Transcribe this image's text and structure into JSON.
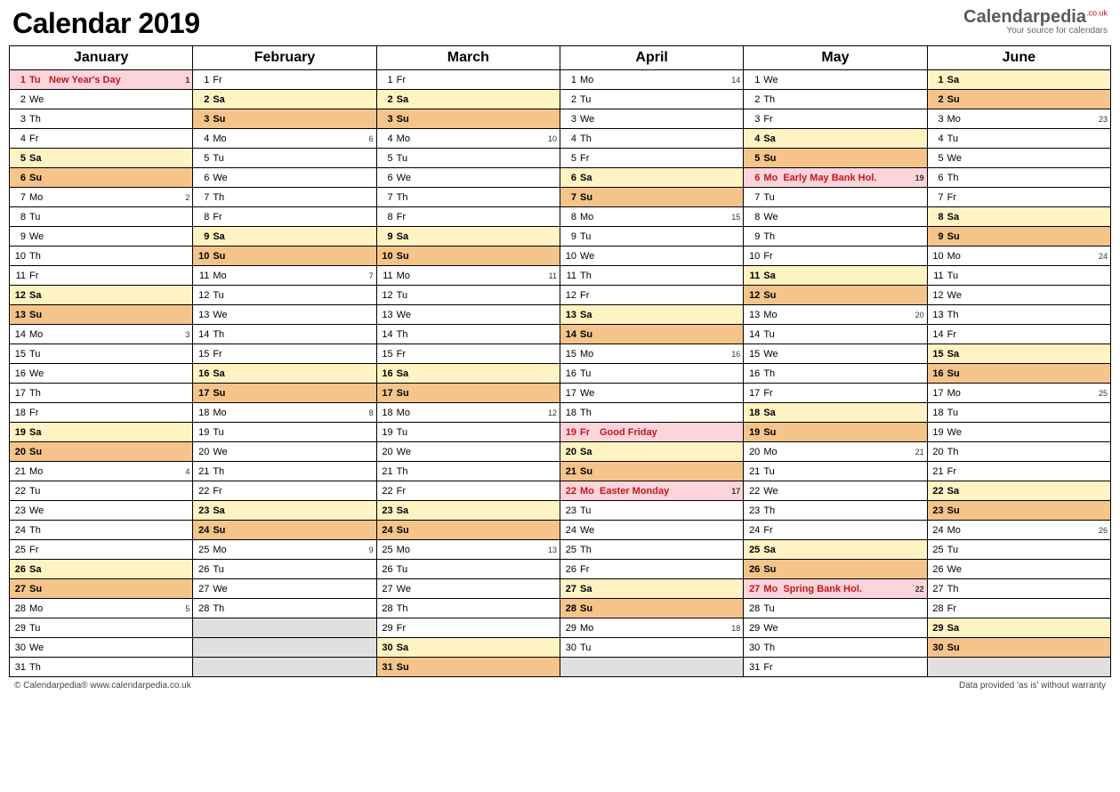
{
  "title": "Calendar 2019",
  "logo": {
    "text": "Calendarpedia",
    "suffix": ".co.uk",
    "tagline": "Your source for calendars"
  },
  "footer": {
    "left": "© Calendarpedia®   www.calendarpedia.co.uk",
    "right": "Data provided 'as is' without warranty"
  },
  "months": [
    "January",
    "February",
    "March",
    "April",
    "May",
    "June"
  ],
  "grid": [
    [
      {
        "d": 1,
        "w": "Tu",
        "e": "New Year's Day",
        "wk": 1,
        "t": "hol"
      },
      {
        "d": 1,
        "w": "Fr"
      },
      {
        "d": 1,
        "w": "Fr"
      },
      {
        "d": 1,
        "w": "Mo",
        "wk": 14
      },
      {
        "d": 1,
        "w": "We"
      },
      {
        "d": 1,
        "w": "Sa",
        "t": "sat"
      }
    ],
    [
      {
        "d": 2,
        "w": "We"
      },
      {
        "d": 2,
        "w": "Sa",
        "t": "sat"
      },
      {
        "d": 2,
        "w": "Sa",
        "t": "sat"
      },
      {
        "d": 2,
        "w": "Tu"
      },
      {
        "d": 2,
        "w": "Th"
      },
      {
        "d": 2,
        "w": "Su",
        "t": "sun"
      }
    ],
    [
      {
        "d": 3,
        "w": "Th"
      },
      {
        "d": 3,
        "w": "Su",
        "t": "sun"
      },
      {
        "d": 3,
        "w": "Su",
        "t": "sun"
      },
      {
        "d": 3,
        "w": "We"
      },
      {
        "d": 3,
        "w": "Fr"
      },
      {
        "d": 3,
        "w": "Mo",
        "wk": 23
      }
    ],
    [
      {
        "d": 4,
        "w": "Fr"
      },
      {
        "d": 4,
        "w": "Mo",
        "wk": 6
      },
      {
        "d": 4,
        "w": "Mo",
        "wk": 10
      },
      {
        "d": 4,
        "w": "Th"
      },
      {
        "d": 4,
        "w": "Sa",
        "t": "sat"
      },
      {
        "d": 4,
        "w": "Tu"
      }
    ],
    [
      {
        "d": 5,
        "w": "Sa",
        "t": "sat"
      },
      {
        "d": 5,
        "w": "Tu"
      },
      {
        "d": 5,
        "w": "Tu"
      },
      {
        "d": 5,
        "w": "Fr"
      },
      {
        "d": 5,
        "w": "Su",
        "t": "sun"
      },
      {
        "d": 5,
        "w": "We"
      }
    ],
    [
      {
        "d": 6,
        "w": "Su",
        "t": "sun"
      },
      {
        "d": 6,
        "w": "We"
      },
      {
        "d": 6,
        "w": "We"
      },
      {
        "d": 6,
        "w": "Sa",
        "t": "sat"
      },
      {
        "d": 6,
        "w": "Mo",
        "e": "Early May Bank Hol.",
        "wk": 19,
        "t": "hol"
      },
      {
        "d": 6,
        "w": "Th"
      }
    ],
    [
      {
        "d": 7,
        "w": "Mo",
        "wk": 2
      },
      {
        "d": 7,
        "w": "Th"
      },
      {
        "d": 7,
        "w": "Th"
      },
      {
        "d": 7,
        "w": "Su",
        "t": "sun"
      },
      {
        "d": 7,
        "w": "Tu"
      },
      {
        "d": 7,
        "w": "Fr"
      }
    ],
    [
      {
        "d": 8,
        "w": "Tu"
      },
      {
        "d": 8,
        "w": "Fr"
      },
      {
        "d": 8,
        "w": "Fr"
      },
      {
        "d": 8,
        "w": "Mo",
        "wk": 15
      },
      {
        "d": 8,
        "w": "We"
      },
      {
        "d": 8,
        "w": "Sa",
        "t": "sat"
      }
    ],
    [
      {
        "d": 9,
        "w": "We"
      },
      {
        "d": 9,
        "w": "Sa",
        "t": "sat"
      },
      {
        "d": 9,
        "w": "Sa",
        "t": "sat"
      },
      {
        "d": 9,
        "w": "Tu"
      },
      {
        "d": 9,
        "w": "Th"
      },
      {
        "d": 9,
        "w": "Su",
        "t": "sun"
      }
    ],
    [
      {
        "d": 10,
        "w": "Th"
      },
      {
        "d": 10,
        "w": "Su",
        "t": "sun"
      },
      {
        "d": 10,
        "w": "Su",
        "t": "sun"
      },
      {
        "d": 10,
        "w": "We"
      },
      {
        "d": 10,
        "w": "Fr"
      },
      {
        "d": 10,
        "w": "Mo",
        "wk": 24
      }
    ],
    [
      {
        "d": 11,
        "w": "Fr"
      },
      {
        "d": 11,
        "w": "Mo",
        "wk": 7
      },
      {
        "d": 11,
        "w": "Mo",
        "wk": 11
      },
      {
        "d": 11,
        "w": "Th"
      },
      {
        "d": 11,
        "w": "Sa",
        "t": "sat"
      },
      {
        "d": 11,
        "w": "Tu"
      }
    ],
    [
      {
        "d": 12,
        "w": "Sa",
        "t": "sat"
      },
      {
        "d": 12,
        "w": "Tu"
      },
      {
        "d": 12,
        "w": "Tu"
      },
      {
        "d": 12,
        "w": "Fr"
      },
      {
        "d": 12,
        "w": "Su",
        "t": "sun"
      },
      {
        "d": 12,
        "w": "We"
      }
    ],
    [
      {
        "d": 13,
        "w": "Su",
        "t": "sun"
      },
      {
        "d": 13,
        "w": "We"
      },
      {
        "d": 13,
        "w": "We"
      },
      {
        "d": 13,
        "w": "Sa",
        "t": "sat"
      },
      {
        "d": 13,
        "w": "Mo",
        "wk": 20
      },
      {
        "d": 13,
        "w": "Th"
      }
    ],
    [
      {
        "d": 14,
        "w": "Mo",
        "wk": 3
      },
      {
        "d": 14,
        "w": "Th"
      },
      {
        "d": 14,
        "w": "Th"
      },
      {
        "d": 14,
        "w": "Su",
        "t": "sun"
      },
      {
        "d": 14,
        "w": "Tu"
      },
      {
        "d": 14,
        "w": "Fr"
      }
    ],
    [
      {
        "d": 15,
        "w": "Tu"
      },
      {
        "d": 15,
        "w": "Fr"
      },
      {
        "d": 15,
        "w": "Fr"
      },
      {
        "d": 15,
        "w": "Mo",
        "wk": 16
      },
      {
        "d": 15,
        "w": "We"
      },
      {
        "d": 15,
        "w": "Sa",
        "t": "sat"
      }
    ],
    [
      {
        "d": 16,
        "w": "We"
      },
      {
        "d": 16,
        "w": "Sa",
        "t": "sat"
      },
      {
        "d": 16,
        "w": "Sa",
        "t": "sat"
      },
      {
        "d": 16,
        "w": "Tu"
      },
      {
        "d": 16,
        "w": "Th"
      },
      {
        "d": 16,
        "w": "Su",
        "t": "sun"
      }
    ],
    [
      {
        "d": 17,
        "w": "Th"
      },
      {
        "d": 17,
        "w": "Su",
        "t": "sun"
      },
      {
        "d": 17,
        "w": "Su",
        "t": "sun"
      },
      {
        "d": 17,
        "w": "We"
      },
      {
        "d": 17,
        "w": "Fr"
      },
      {
        "d": 17,
        "w": "Mo",
        "wk": 25
      }
    ],
    [
      {
        "d": 18,
        "w": "Fr"
      },
      {
        "d": 18,
        "w": "Mo",
        "wk": 8
      },
      {
        "d": 18,
        "w": "Mo",
        "wk": 12
      },
      {
        "d": 18,
        "w": "Th"
      },
      {
        "d": 18,
        "w": "Sa",
        "t": "sat"
      },
      {
        "d": 18,
        "w": "Tu"
      }
    ],
    [
      {
        "d": 19,
        "w": "Sa",
        "t": "sat"
      },
      {
        "d": 19,
        "w": "Tu"
      },
      {
        "d": 19,
        "w": "Tu"
      },
      {
        "d": 19,
        "w": "Fr",
        "e": "Good Friday",
        "t": "hol"
      },
      {
        "d": 19,
        "w": "Su",
        "t": "sun"
      },
      {
        "d": 19,
        "w": "We"
      }
    ],
    [
      {
        "d": 20,
        "w": "Su",
        "t": "sun"
      },
      {
        "d": 20,
        "w": "We"
      },
      {
        "d": 20,
        "w": "We"
      },
      {
        "d": 20,
        "w": "Sa",
        "t": "sat"
      },
      {
        "d": 20,
        "w": "Mo",
        "wk": 21
      },
      {
        "d": 20,
        "w": "Th"
      }
    ],
    [
      {
        "d": 21,
        "w": "Mo",
        "wk": 4
      },
      {
        "d": 21,
        "w": "Th"
      },
      {
        "d": 21,
        "w": "Th"
      },
      {
        "d": 21,
        "w": "Su",
        "t": "sun"
      },
      {
        "d": 21,
        "w": "Tu"
      },
      {
        "d": 21,
        "w": "Fr"
      }
    ],
    [
      {
        "d": 22,
        "w": "Tu"
      },
      {
        "d": 22,
        "w": "Fr"
      },
      {
        "d": 22,
        "w": "Fr"
      },
      {
        "d": 22,
        "w": "Mo",
        "e": "Easter Monday",
        "wk": 17,
        "t": "hol"
      },
      {
        "d": 22,
        "w": "We"
      },
      {
        "d": 22,
        "w": "Sa",
        "t": "sat"
      }
    ],
    [
      {
        "d": 23,
        "w": "We"
      },
      {
        "d": 23,
        "w": "Sa",
        "t": "sat"
      },
      {
        "d": 23,
        "w": "Sa",
        "t": "sat"
      },
      {
        "d": 23,
        "w": "Tu"
      },
      {
        "d": 23,
        "w": "Th"
      },
      {
        "d": 23,
        "w": "Su",
        "t": "sun"
      }
    ],
    [
      {
        "d": 24,
        "w": "Th"
      },
      {
        "d": 24,
        "w": "Su",
        "t": "sun"
      },
      {
        "d": 24,
        "w": "Su",
        "t": "sun"
      },
      {
        "d": 24,
        "w": "We"
      },
      {
        "d": 24,
        "w": "Fr"
      },
      {
        "d": 24,
        "w": "Mo",
        "wk": 26
      }
    ],
    [
      {
        "d": 25,
        "w": "Fr"
      },
      {
        "d": 25,
        "w": "Mo",
        "wk": 9
      },
      {
        "d": 25,
        "w": "Mo",
        "wk": 13
      },
      {
        "d": 25,
        "w": "Th"
      },
      {
        "d": 25,
        "w": "Sa",
        "t": "sat"
      },
      {
        "d": 25,
        "w": "Tu"
      }
    ],
    [
      {
        "d": 26,
        "w": "Sa",
        "t": "sat"
      },
      {
        "d": 26,
        "w": "Tu"
      },
      {
        "d": 26,
        "w": "Tu"
      },
      {
        "d": 26,
        "w": "Fr"
      },
      {
        "d": 26,
        "w": "Su",
        "t": "sun"
      },
      {
        "d": 26,
        "w": "We"
      }
    ],
    [
      {
        "d": 27,
        "w": "Su",
        "t": "sun"
      },
      {
        "d": 27,
        "w": "We"
      },
      {
        "d": 27,
        "w": "We"
      },
      {
        "d": 27,
        "w": "Sa",
        "t": "sat"
      },
      {
        "d": 27,
        "w": "Mo",
        "e": "Spring Bank Hol.",
        "wk": 22,
        "t": "hol"
      },
      {
        "d": 27,
        "w": "Th"
      }
    ],
    [
      {
        "d": 28,
        "w": "Mo",
        "wk": 5
      },
      {
        "d": 28,
        "w": "Th"
      },
      {
        "d": 28,
        "w": "Th"
      },
      {
        "d": 28,
        "w": "Su",
        "t": "sun"
      },
      {
        "d": 28,
        "w": "Tu"
      },
      {
        "d": 28,
        "w": "Fr"
      }
    ],
    [
      {
        "d": 29,
        "w": "Tu"
      },
      null,
      {
        "d": 29,
        "w": "Fr"
      },
      {
        "d": 29,
        "w": "Mo",
        "wk": 18
      },
      {
        "d": 29,
        "w": "We"
      },
      {
        "d": 29,
        "w": "Sa",
        "t": "sat"
      }
    ],
    [
      {
        "d": 30,
        "w": "We"
      },
      null,
      {
        "d": 30,
        "w": "Sa",
        "t": "sat"
      },
      {
        "d": 30,
        "w": "Tu"
      },
      {
        "d": 30,
        "w": "Th"
      },
      {
        "d": 30,
        "w": "Su",
        "t": "sun"
      }
    ],
    [
      {
        "d": 31,
        "w": "Th"
      },
      null,
      {
        "d": 31,
        "w": "Su",
        "t": "sun"
      },
      null,
      {
        "d": 31,
        "w": "Fr"
      },
      null
    ]
  ]
}
